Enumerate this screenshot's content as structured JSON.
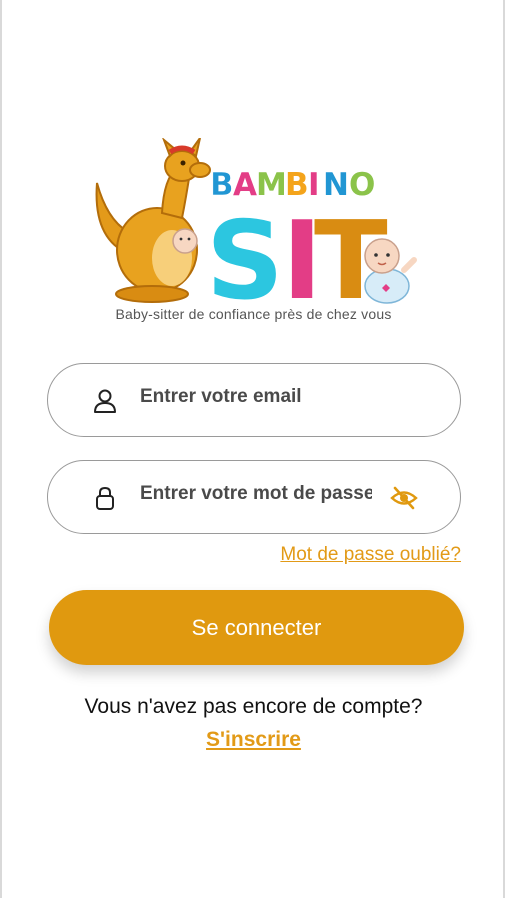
{
  "brand": {
    "logo_name": "BAMBINO SIT",
    "logo_top": "BAMBINO",
    "logo_bottom": "SIT",
    "tagline": "Baby-sitter de confiance près de chez vous"
  },
  "login": {
    "email_placeholder": "Entrer votre email",
    "password_placeholder": "Entrer votre mot de passe",
    "forgot_label": "Mot de passe oublié?",
    "submit_label": "Se connecter"
  },
  "signup": {
    "prompt": "Vous n'avez pas encore de compte?",
    "link_label": "S'inscrire"
  },
  "colors": {
    "accent": "#e0990f",
    "link": "#e29a17",
    "border": "#9a9a9a"
  },
  "icons": {
    "email": "user-icon",
    "password": "lock-icon",
    "toggle": "eye-off-icon"
  }
}
